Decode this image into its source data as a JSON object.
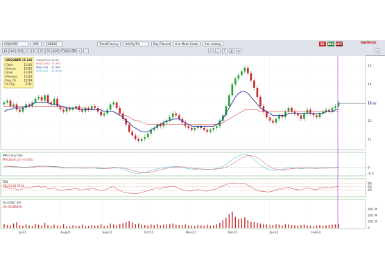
{
  "toolbar": {
    "ticker": "GSQUARE",
    "interval": "30M",
    "frequency_options": [
      "1D",
      "1W",
      "1M",
      "1Y",
      "2Y",
      "3Y",
      "5Y",
      "10Y",
      "YTD",
      "CUSTOM"
    ],
    "chart_style": "CANDLE",
    "study_menu": "Trend/Fluency",
    "indicator_menu": "Vol/Vty/Trd",
    "zoom_label": "Day Planner",
    "line_mode": "Line Mode (Auto)",
    "event_label": "Ann Lookup",
    "badges": [
      {
        "label": "EX",
        "color": "#c62828"
      },
      {
        "label": "BLK",
        "color": "#2e7d32"
      },
      {
        "label": "DRT",
        "color": "#8d1b1b"
      }
    ],
    "right_label": "MATRIXX"
  },
  "info_box": {
    "title": "GSQUARE (3.14)",
    "rows": [
      {
        "label": "Close",
        "value": "13.00"
      },
      {
        "label": "Volume",
        "value": "13.83"
      },
      {
        "label": "Open",
        "value": "13.00"
      },
      {
        "label": "Previous",
        "value": "13.00"
      },
      {
        "label": "Avg. Ch.",
        "value": "12.94"
      },
      {
        "label": "% Chg",
        "value": "0.31"
      }
    ]
  },
  "price_panel": {
    "legend": [
      {
        "label": "Close/Price",
        "value": "12.94",
        "color": "#444444"
      },
      {
        "label": "MA(5,200)",
        "value": "12.387",
        "color": "#d33b3b"
      },
      {
        "label": "MA(5,50)",
        "value": "12.945",
        "color": "#1f2f9e"
      },
      {
        "label": "MA(5,20)",
        "value": "12.4002",
        "color": "#2f9fbf"
      }
    ],
    "y_ticks": [
      "15.",
      "14.",
      "13.",
      "12.",
      "11."
    ],
    "last_price": "12.94"
  },
  "macd_panel": {
    "title": "MA Conv Div",
    "legend": "MACD(26,12)   -0.0181",
    "y_ticks": [
      "0",
      "-0.5"
    ]
  },
  "rsi_panel": {
    "title": "RSI",
    "legend": "RSI 14   56.3534",
    "y_ticks": [
      "80.",
      "60.",
      "40."
    ]
  },
  "volume_panel": {
    "title": "Acc/Dist Vol",
    "legend": "Vol   66286860",
    "y_ticks": [
      "300. M",
      "200. M",
      "100. M",
      "0."
    ]
  },
  "x_axis": {
    "labels": [
      "Jul21",
      "Aug21",
      "Sep21",
      "Oct21",
      "Nov21",
      "Dec21",
      "Jan22",
      "Feb22"
    ]
  },
  "colors": {
    "up": "#2a9d3a",
    "down": "#c62828",
    "ma_blue": "#1f2f9e",
    "ma_red": "#d33b3b",
    "macd_cyan": "#4cc3d9",
    "cursor": "#a230c8",
    "rsi_line": "#c62828",
    "volume_bars": "#c62828"
  },
  "chart_data": {
    "type": "candlestick",
    "x_range": [
      "Jun21",
      "Feb22"
    ],
    "ylim": [
      10.5,
      15.5
    ],
    "price_close": [
      13.0,
      13.1,
      12.8,
      12.9,
      12.6,
      12.5,
      12.7,
      12.9,
      12.8,
      13.0,
      13.2,
      13.3,
      13.1,
      13.4,
      13.0,
      12.9,
      13.2,
      12.8,
      12.6,
      12.5,
      12.7,
      12.6,
      12.7,
      12.8,
      12.6,
      12.5,
      12.7,
      12.6,
      12.8,
      12.7,
      12.5,
      12.3,
      12.4,
      12.6,
      12.9,
      13.0,
      12.7,
      12.4,
      12.1,
      11.8,
      11.4,
      11.2,
      11.0,
      10.9,
      11.0,
      11.1,
      11.3,
      11.5,
      11.6,
      11.8,
      11.7,
      11.9,
      12.0,
      12.2,
      12.4,
      12.3,
      12.1,
      11.9,
      11.7,
      11.6,
      11.5,
      11.6,
      11.7,
      11.6,
      11.5,
      11.4,
      11.5,
      11.6,
      11.7,
      12.0,
      12.3,
      12.8,
      13.4,
      14.0,
      14.3,
      14.5,
      14.7,
      14.9,
      14.6,
      14.2,
      13.8,
      13.3,
      12.8,
      12.5,
      12.2,
      12.0,
      11.9,
      12.1,
      12.3,
      12.2,
      12.5,
      12.7,
      12.5,
      12.4,
      12.3,
      12.1,
      12.4,
      12.6,
      12.4,
      12.3,
      12.2,
      12.4,
      12.5,
      12.6,
      12.5,
      12.7,
      12.8,
      13.0
    ],
    "ma_blue": [
      12.5,
      12.6,
      12.6,
      12.7,
      12.7,
      12.7,
      12.7,
      12.8,
      12.8,
      12.9,
      13.0,
      13.0,
      13.0,
      13.0,
      13.0,
      12.9,
      12.9,
      12.9,
      12.8,
      12.8,
      12.7,
      12.7,
      12.7,
      12.7,
      12.6,
      12.6,
      12.6,
      12.6,
      12.6,
      12.6,
      12.6,
      12.6,
      12.5,
      12.5,
      12.5,
      12.5,
      12.4,
      12.3,
      12.2,
      12.0,
      11.9,
      11.7,
      11.6,
      11.5,
      11.4,
      11.4,
      11.4,
      11.5,
      11.6,
      11.7,
      11.8,
      11.9,
      12.0,
      12.0,
      12.1,
      12.1,
      12.1,
      12.0,
      11.9,
      11.8,
      11.7,
      11.7,
      11.7,
      11.7,
      11.7,
      11.7,
      11.7,
      11.7,
      11.8,
      11.9,
      12.1,
      12.4,
      12.7,
      13.0,
      13.3,
      13.5,
      13.6,
      13.6,
      13.5,
      13.3,
      13.1,
      12.9,
      12.7,
      12.6,
      12.5,
      12.4,
      12.3,
      12.3,
      12.3,
      12.3,
      12.3,
      12.4,
      12.4,
      12.4,
      12.4,
      12.4,
      12.4,
      12.4,
      12.4,
      12.4,
      12.4,
      12.4,
      12.4,
      12.5,
      12.5,
      12.5,
      12.6,
      12.6
    ],
    "ma_red": [
      12.8,
      12.8,
      12.8,
      12.8,
      12.8,
      12.8,
      12.8,
      12.8,
      12.8,
      12.8,
      12.8,
      12.8,
      12.8,
      12.8,
      12.8,
      12.8,
      12.8,
      12.8,
      12.8,
      12.7,
      12.7,
      12.7,
      12.7,
      12.7,
      12.7,
      12.7,
      12.7,
      12.6,
      12.6,
      12.6,
      12.6,
      12.6,
      12.5,
      12.5,
      12.5,
      12.5,
      12.4,
      12.4,
      12.3,
      12.3,
      12.2,
      12.1,
      12.0,
      12.0,
      11.9,
      11.9,
      11.8,
      11.8,
      11.8,
      11.8,
      11.8,
      11.8,
      11.8,
      11.8,
      11.8,
      11.8,
      11.8,
      11.8,
      11.8,
      11.8,
      11.8,
      11.8,
      11.8,
      11.8,
      11.8,
      11.8,
      11.8,
      11.8,
      11.8,
      11.8,
      11.9,
      12.0,
      12.1,
      12.2,
      12.3,
      12.4,
      12.5,
      12.6,
      12.6,
      12.6,
      12.6,
      12.6,
      12.5,
      12.5,
      12.5,
      12.5,
      12.5,
      12.5,
      12.5,
      12.5,
      12.5,
      12.5,
      12.5,
      12.5,
      12.5,
      12.5,
      12.5,
      12.5,
      12.5,
      12.5,
      12.5,
      12.5,
      12.5,
      12.5,
      12.5,
      12.5,
      12.5,
      12.5
    ],
    "macd": [
      0.1,
      0.12,
      0.08,
      0.06,
      0.02,
      0.0,
      0.02,
      0.05,
      0.06,
      0.08,
      0.12,
      0.15,
      0.12,
      0.14,
      0.1,
      0.06,
      0.08,
      0.03,
      -0.02,
      -0.05,
      -0.03,
      -0.04,
      -0.03,
      -0.02,
      -0.04,
      -0.06,
      -0.04,
      -0.05,
      -0.03,
      -0.04,
      -0.07,
      -0.1,
      -0.1,
      -0.06,
      0.0,
      0.04,
      0.0,
      -0.06,
      -0.14,
      -0.24,
      -0.34,
      -0.42,
      -0.48,
      -0.5,
      -0.47,
      -0.42,
      -0.35,
      -0.26,
      -0.18,
      -0.1,
      -0.06,
      -0.02,
      0.02,
      0.06,
      0.1,
      0.1,
      0.06,
      0.0,
      -0.06,
      -0.1,
      -0.14,
      -0.14,
      -0.12,
      -0.12,
      -0.14,
      -0.16,
      -0.14,
      -0.12,
      -0.08,
      0.0,
      0.1,
      0.26,
      0.46,
      0.7,
      0.88,
      1.0,
      1.1,
      1.15,
      1.08,
      0.92,
      0.7,
      0.46,
      0.22,
      0.04,
      -0.1,
      -0.2,
      -0.26,
      -0.24,
      -0.18,
      -0.16,
      -0.08,
      -0.02,
      -0.02,
      -0.04,
      -0.06,
      -0.1,
      -0.06,
      -0.02,
      -0.04,
      -0.06,
      -0.08,
      -0.05,
      -0.03,
      -0.02,
      -0.03,
      0.0,
      0.02,
      0.06
    ],
    "rsi": [
      55,
      58,
      48,
      52,
      44,
      42,
      50,
      56,
      52,
      58,
      62,
      64,
      56,
      64,
      50,
      46,
      56,
      44,
      40,
      38,
      46,
      44,
      48,
      50,
      44,
      40,
      48,
      44,
      52,
      48,
      42,
      36,
      40,
      48,
      58,
      60,
      48,
      38,
      30,
      26,
      22,
      22,
      20,
      22,
      28,
      32,
      38,
      44,
      48,
      54,
      50,
      56,
      58,
      62,
      64,
      58,
      50,
      44,
      38,
      36,
      34,
      40,
      44,
      40,
      36,
      34,
      40,
      44,
      48,
      58,
      66,
      74,
      80,
      84,
      80,
      76,
      78,
      80,
      68,
      58,
      48,
      40,
      34,
      32,
      30,
      30,
      34,
      42,
      48,
      46,
      54,
      58,
      50,
      46,
      44,
      40,
      50,
      56,
      48,
      46,
      44,
      52,
      54,
      56,
      52,
      58,
      60,
      62
    ],
    "volume_millions": [
      60,
      45,
      40,
      70,
      90,
      40,
      35,
      55,
      40,
      30,
      65,
      50,
      35,
      80,
      45,
      30,
      50,
      40,
      35,
      60,
      30,
      25,
      40,
      35,
      30,
      50,
      25,
      30,
      45,
      35,
      40,
      55,
      30,
      40,
      70,
      55,
      45,
      60,
      75,
      90,
      110,
      85,
      60,
      70,
      50,
      45,
      40,
      55,
      45,
      60,
      40,
      50,
      55,
      60,
      70,
      50,
      45,
      40,
      55,
      40,
      35,
      30,
      45,
      40,
      35,
      50,
      35,
      40,
      55,
      80,
      120,
      160,
      220,
      260,
      180,
      140,
      150,
      170,
      120,
      100,
      90,
      80,
      70,
      60,
      55,
      50,
      45,
      55,
      50,
      40,
      60,
      55,
      45,
      40,
      35,
      45,
      50,
      40,
      35,
      30,
      40,
      45,
      35,
      40,
      45,
      50,
      55,
      60
    ]
  }
}
